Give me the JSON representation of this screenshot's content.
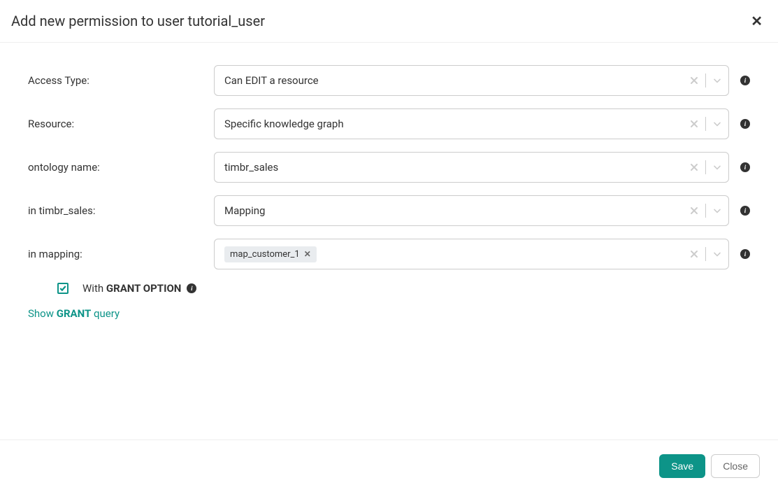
{
  "header": {
    "title": "Add new permission to user tutorial_user"
  },
  "form": {
    "rows": [
      {
        "label": "Access Type:",
        "value": "Can EDIT a resource"
      },
      {
        "label": "Resource:",
        "value": "Specific knowledge graph"
      },
      {
        "label": "ontology name:",
        "value": "timbr_sales"
      },
      {
        "label": "in timbr_sales:",
        "value": "Mapping"
      }
    ],
    "mapping_row": {
      "label": "in mapping:",
      "tag": "map_customer_1"
    },
    "grant_option": {
      "prefix": "With ",
      "bold": "GRANT OPTION"
    },
    "show_query": {
      "prefix": "Show ",
      "bold": "GRANT",
      "suffix": " query"
    }
  },
  "footer": {
    "save": "Save",
    "close": "Close"
  }
}
